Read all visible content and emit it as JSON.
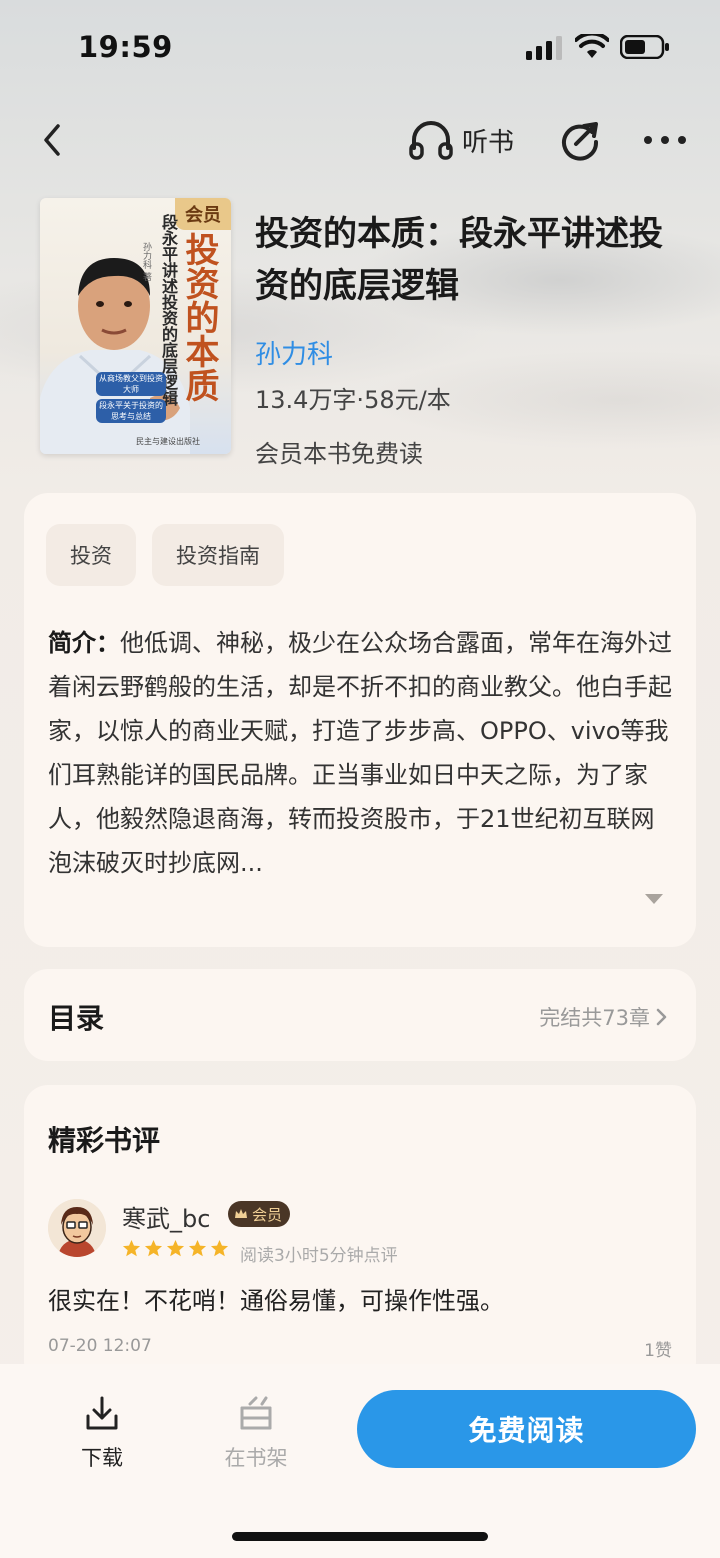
{
  "status_bar": {
    "time": "19:59"
  },
  "nav": {
    "listen_label": "听书"
  },
  "book": {
    "cover": {
      "badge": "会员",
      "title": "投资的本质",
      "subtitle": "段永平讲述投资的底层逻辑",
      "author": "孙力科 著",
      "blurb": [
        "从商场教父到投资大师",
        "段永平关于投资的思考与总结"
      ],
      "publisher": "民主与建设出版社"
    },
    "title": "投资的本质：段永平讲述投资的底层逻辑",
    "author": "孙力科",
    "meta": "13.4万字·58元/本",
    "free_note": "会员本书免费读"
  },
  "intro": {
    "tags": [
      "投资",
      "投资指南"
    ],
    "prefix": "简介：",
    "text": "他低调、神秘，极少在公众场合露面，常年在海外过着闲云野鹤般的生活，却是不折不扣的商业教父。他白手起家，以惊人的商业天赋，打造了步步高、OPPO、vivo等我们耳熟能详的国民品牌。正当事业如日中天之际，为了家人，他毅然隐退商海，转而投资股市，于21世纪初互联网泡沫破灭时抄底网..."
  },
  "toc": {
    "title": "目录",
    "info": "完结共73章"
  },
  "reviews": {
    "title": "精彩书评",
    "items": [
      {
        "name": "寒武_bc",
        "badge": "会员",
        "rating": 5,
        "read_time": "阅读3小时5分钟点评",
        "text": "很实在！不花哨！通俗易懂，可操作性强。",
        "date": "07-20 12:07",
        "likes": "1赞"
      }
    ]
  },
  "bottom": {
    "download_label": "下载",
    "shelf_label": "在书架",
    "read_label": "免费阅读"
  },
  "colors": {
    "accent": "#2a97e8",
    "author_link": "#2f8de4",
    "card_bg": "#fcf6f1",
    "star": "#f5b428"
  }
}
